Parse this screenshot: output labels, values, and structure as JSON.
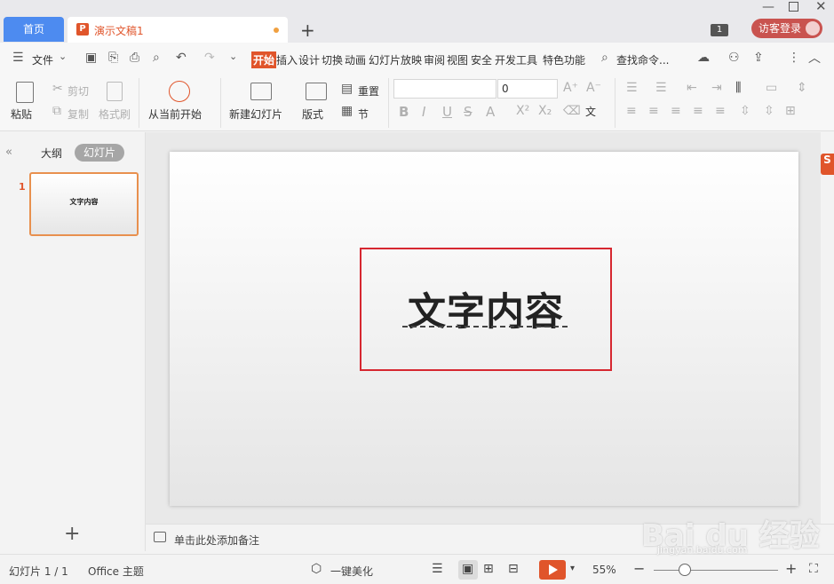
{
  "tabs": {
    "home": "首页",
    "doc": "演示文稿1"
  },
  "window": {
    "page_badge": "1",
    "login": "访客登录"
  },
  "menu": {
    "file": "文件",
    "items": [
      "开始",
      "插入",
      "设计",
      "切换",
      "动画",
      "幻灯片放映",
      "审阅",
      "视图",
      "安全",
      "开发工具",
      "特色功能"
    ],
    "search": "查找命令..."
  },
  "ribbon": {
    "paste": "粘贴",
    "cut": "剪切",
    "copy": "复制",
    "format_painter": "格式刷",
    "from_current": "从当前开始",
    "new_slide": "新建幻灯片",
    "layout": "版式",
    "reset": "重置",
    "section": "节",
    "font_size": "0"
  },
  "left_panel": {
    "outline": "大纲",
    "slides": "幻灯片",
    "slide_num": "1",
    "thumb_text": "文字内容"
  },
  "slide": {
    "text": "文字内容"
  },
  "notes": {
    "placeholder": "单击此处添加备注"
  },
  "status": {
    "slide_count": "幻灯片 1 / 1",
    "theme": "Office 主题",
    "beautify": "一键美化",
    "zoom": "55%"
  },
  "watermark": {
    "main": "Bai du 经验",
    "sub": "jingyan.baidu.com"
  }
}
